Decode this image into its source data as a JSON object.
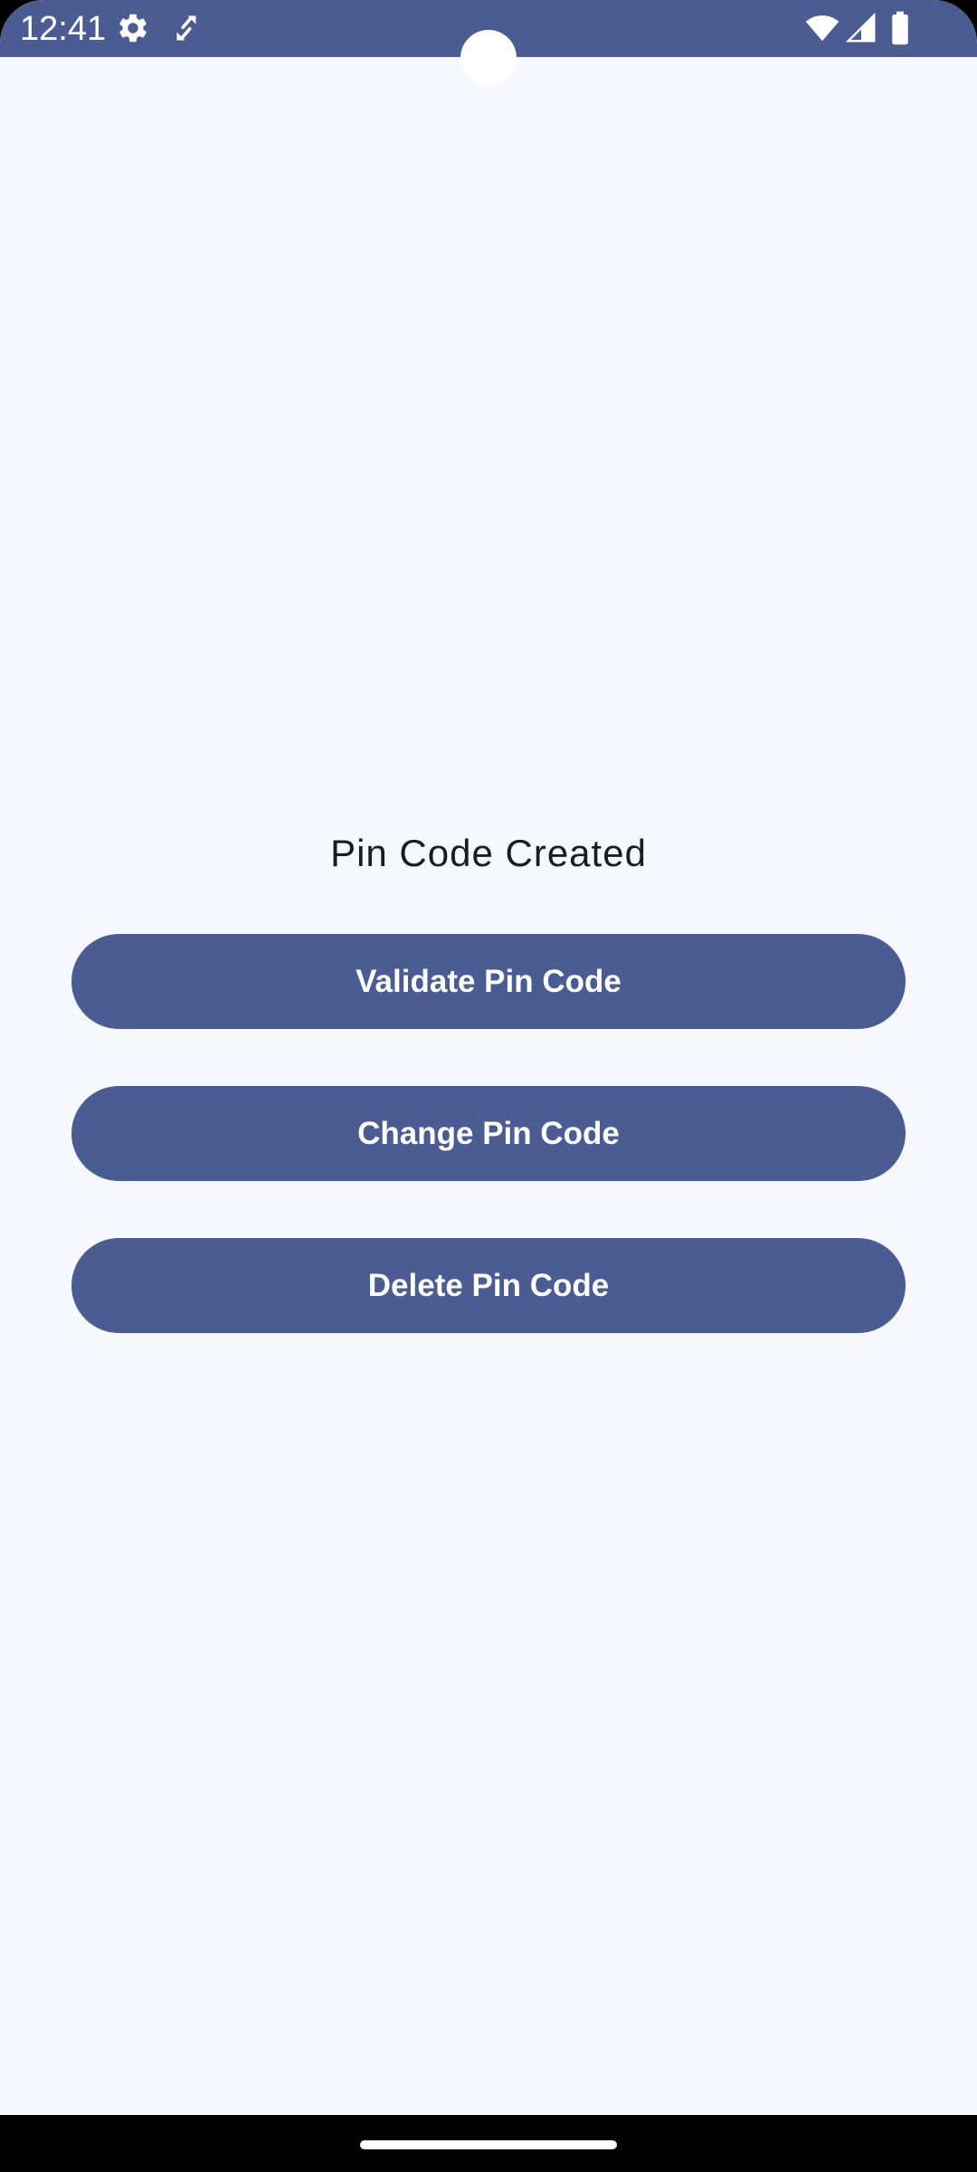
{
  "status_bar": {
    "time": "12:41",
    "background_color": "#4A5C92",
    "icons_left": [
      "gear-icon",
      "screen-rotate-icon"
    ],
    "icons_right": [
      "wifi-icon",
      "cellular-signal-icon",
      "battery-icon"
    ]
  },
  "main": {
    "title": "Pin Code Created",
    "buttons": {
      "validate_label": "Validate Pin Code",
      "change_label": "Change Pin Code",
      "delete_label": "Delete Pin Code"
    }
  },
  "colors": {
    "primary": "#4A5C92",
    "background": "#F7F8FD",
    "text": "#1B1B21",
    "on_primary": "#FFFFFF"
  }
}
